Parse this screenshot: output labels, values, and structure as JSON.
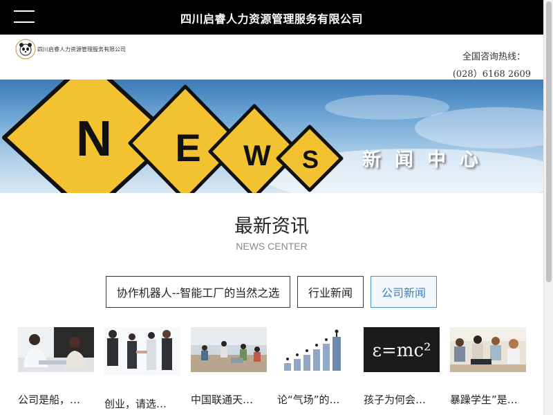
{
  "topbar": {
    "menu_icon": "hamburger-menu-icon",
    "title": "四川启睿人力资源管理服务有限公司"
  },
  "header": {
    "logo_icon": "panda-logo-icon",
    "logo_text": "四川启睿人力资源管理服务有限公司",
    "hotline_label": "全国咨询热线：",
    "hotline_number": "(028）6168 2609"
  },
  "banner": {
    "letters": [
      "N",
      "E",
      "W",
      "S"
    ],
    "caption": "新闻中心",
    "sign_color": "#f2c230",
    "sign_border_color": "#111111"
  },
  "section": {
    "title": "最新资讯",
    "subtitle": "NEWS CENTER"
  },
  "tabs": [
    {
      "label": "协作机器人--智能工厂的当然之选",
      "active": false
    },
    {
      "label": "行业新闻",
      "active": false
    },
    {
      "label": "公司新闻",
      "active": true
    }
  ],
  "news": [
    {
      "title": "公司是船，…",
      "image_icon": "office-meeting-photo-icon"
    },
    {
      "title": "创业，请选…",
      "image_icon": "business-handshake-photo-icon"
    },
    {
      "title": "中国联通天…",
      "image_icon": "office-workspace-photo-icon"
    },
    {
      "title": "论“气场”的…",
      "image_icon": "growth-chart-photo-icon"
    },
    {
      "title": "孩子为何会…",
      "image_icon": "chalkboard-formula-photo-icon"
    },
    {
      "title": "暴躁学生”是…",
      "image_icon": "students-laptop-photo-icon"
    }
  ],
  "colors": {
    "topbar_bg": "#000000",
    "active_tab_accent": "#3a7fc0"
  }
}
